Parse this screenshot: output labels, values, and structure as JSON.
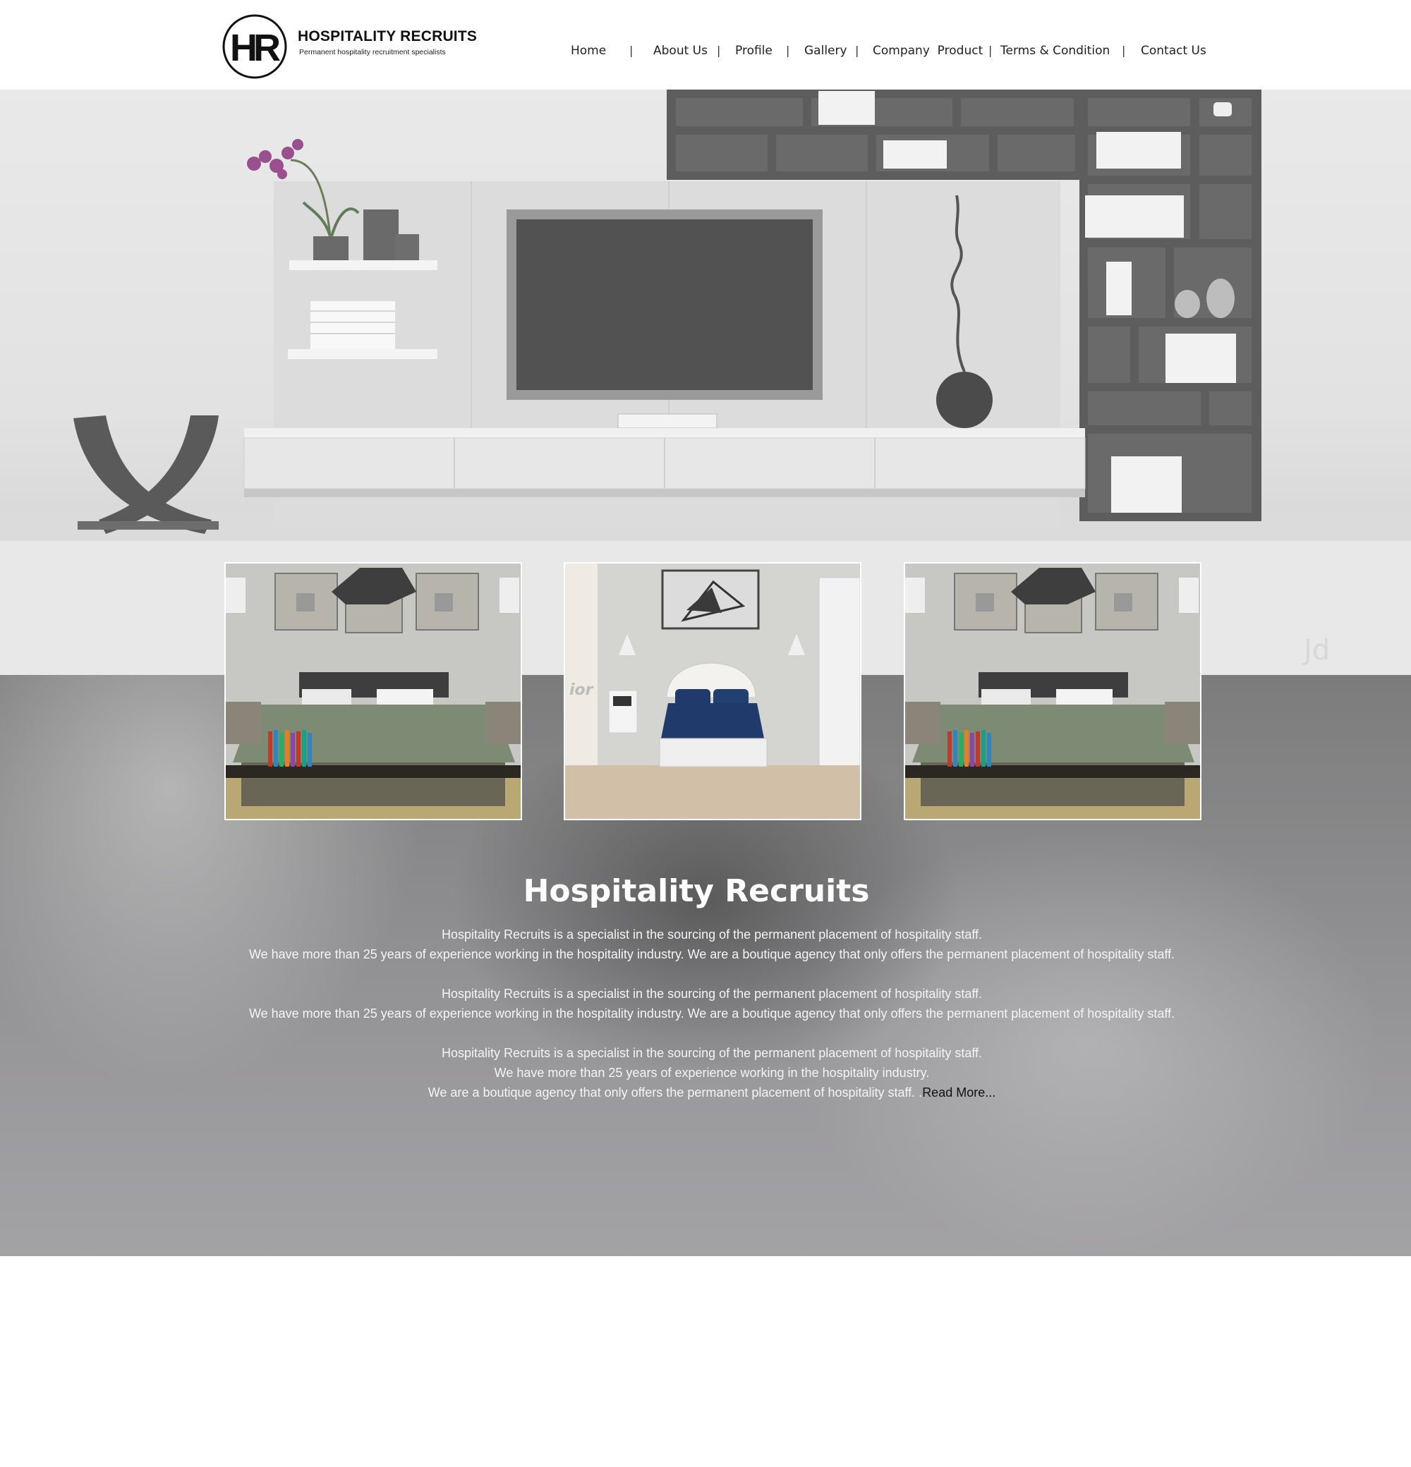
{
  "brand": {
    "mark": "HR",
    "title": "HOSPITALITY RECRUITS",
    "tagline": "Permanent hospitality recruitment specialists"
  },
  "nav": {
    "items": [
      {
        "label": "Home"
      },
      {
        "label": "About Us"
      },
      {
        "label": "Profile"
      },
      {
        "label": "Gallery"
      },
      {
        "label": "Company  Product"
      },
      {
        "label": "Terms & Condition"
      },
      {
        "label": "Contact Us"
      }
    ],
    "separator": "|"
  },
  "gallery": {
    "images": [
      {
        "name": "bedroom-green"
      },
      {
        "name": "bedroom-blue"
      },
      {
        "name": "bedroom-green"
      }
    ]
  },
  "content": {
    "title": "Hospitality Recruits",
    "paragraphs": [
      {
        "line1": "Hospitality Recruits is a specialist in the sourcing of the permanent placement of hospitality staff.",
        "line2": "We have more than 25 years of experience working in the hospitality industry. We are a boutique agency that only offers the permanent placement of hospitality staff."
      },
      {
        "line1": "Hospitality Recruits is a specialist in the sourcing of the permanent placement of hospitality staff.",
        "line2": "We have more than 25 years of experience working in the hospitality industry. We are a boutique agency that only offers the permanent placement of hospitality staff."
      },
      {
        "line1": "Hospitality Recruits is a specialist in the sourcing of the permanent placement of hospitality staff.",
        "line2": "We have more than 25 years of experience working in the hospitality industry.",
        "line3": "We are a boutique agency that only offers the permanent placement of hospitality staff. .",
        "read_more": "Read More..."
      }
    ]
  },
  "colors": {
    "accent_orchid": "#9a4f8e",
    "hero_bg": "#e4e4e4",
    "section_gray": "#8f8f91",
    "tv_screen": "#525252",
    "blue_bedding": "#1f3a6b",
    "green_bedding": "#7d8b74"
  }
}
